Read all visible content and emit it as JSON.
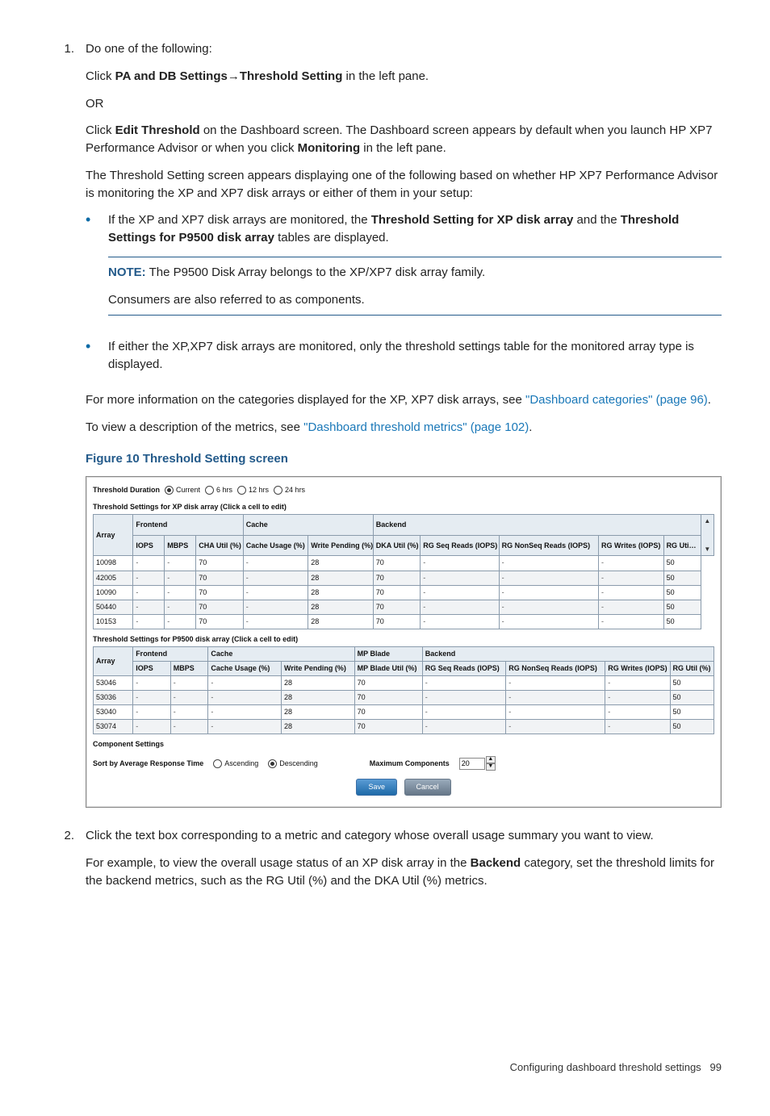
{
  "step1": {
    "num": "1.",
    "intro": "Do one of the following:",
    "click1_a": "Click ",
    "click1_b": "PA and DB Settings",
    "click1_c": "→",
    "click1_d": "Threshold Setting",
    "click1_e": " in the left pane.",
    "or": "OR",
    "click2_a": "Click ",
    "click2_b": "Edit Threshold",
    "click2_c": " on the Dashboard screen. The Dashboard screen appears by default when you launch HP XP7 Performance Advisor or when you click ",
    "click2_d": "Monitoring",
    "click2_e": " in the left pane.",
    "para2": "The Threshold Setting screen appears displaying one of the following based on whether HP XP7 Performance Advisor is monitoring the XP and XP7 disk arrays or either of them in your setup:",
    "bullet1_a": "If the XP and XP7 disk arrays are monitored, the ",
    "bullet1_b": "Threshold Setting for XP disk array",
    "bullet1_c": " and the ",
    "bullet1_d": "Threshold Settings for P9500 disk array",
    "bullet1_e": " tables are displayed.",
    "note_label": "NOTE:",
    "note_line1": " The P9500 Disk Array belongs to the XP/XP7 disk array family.",
    "note_line2": "Consumers are also referred to as components.",
    "bullet2": "If either the XP,XP7 disk arrays are monitored, only the threshold settings table for the monitored array type is displayed.",
    "more_a": "For more information on the categories displayed for the XP, XP7 disk arrays, see ",
    "more_link1": "\"Dashboard categories\" (page 96)",
    "more_b": ".",
    "desc_a": "To view a description of the metrics, see ",
    "desc_link": "\"Dashboard threshold metrics\" (page 102)",
    "desc_b": ".",
    "figure": "Figure 10 Threshold Setting screen"
  },
  "screenshot": {
    "dur_label": "Threshold Duration",
    "opt_current": "Current",
    "opt_6": "6 hrs",
    "opt_12": "12 hrs",
    "opt_24": "24 hrs",
    "xp_title": "Threshold Settings for XP disk array (Click a cell to edit)",
    "p95_title": "Threshold Settings for P9500 disk array (Click a cell to edit)",
    "col_array": "Array",
    "col_frontend": "Frontend",
    "col_cache": "Cache",
    "col_backend": "Backend",
    "col_mpblade": "MP Blade",
    "sub_iops": "IOPS",
    "sub_mbps": "MBPS",
    "sub_cha": "CHA Util (%)",
    "sub_cacheuse": "Cache Usage (%)",
    "sub_wpend": "Write Pending (%)",
    "sub_dka": "DKA Util (%)",
    "sub_rgseq": "RG Seq Reads (IOPS)",
    "sub_rgnonseq": "RG NonSeq Reads (IOPS)",
    "sub_rgwrites": "RG Writes (IOPS)",
    "sub_rgutil": "RG Uti…",
    "sub_rgutil_full": "RG Util (%)",
    "sub_mpbladeutil": "MP Blade Util (%)",
    "xp_rows": [
      {
        "array": "10098",
        "cha": "70",
        "wpend": "28",
        "dka": "70",
        "rgutil": "50"
      },
      {
        "array": "42005",
        "cha": "70",
        "wpend": "28",
        "dka": "70",
        "rgutil": "50",
        "hl": true
      },
      {
        "array": "10090",
        "cha": "70",
        "wpend": "28",
        "dka": "70",
        "rgutil": "50"
      },
      {
        "array": "50440",
        "cha": "70",
        "wpend": "28",
        "dka": "70",
        "rgutil": "50"
      },
      {
        "array": "10153",
        "cha": "70",
        "wpend": "28",
        "dka": "70",
        "rgutil": "50"
      }
    ],
    "p95_rows": [
      {
        "array": "53046",
        "wpend": "28",
        "mpb": "70",
        "rgutil": "50"
      },
      {
        "array": "53036",
        "wpend": "28",
        "mpb": "70",
        "rgutil": "50"
      },
      {
        "array": "53040",
        "wpend": "28",
        "mpb": "70",
        "rgutil": "50"
      },
      {
        "array": "53074",
        "wpend": "28",
        "mpb": "70",
        "rgutil": "50"
      }
    ],
    "comp_label": "Component Settings",
    "sort_label": "Sort by Average Response Time",
    "asc": "Ascending",
    "desc": "Descending",
    "max_label": "Maximum Components",
    "max_val": "20",
    "save": "Save",
    "cancel": "Cancel"
  },
  "step2": {
    "num": "2.",
    "p1": "Click the text box corresponding to a metric and category whose overall usage summary you want to view.",
    "p2_a": "For example, to view the overall usage status of an XP disk array in the ",
    "p2_b": "Backend",
    "p2_c": " category, set the threshold limits for the backend metrics, such as the RG Util (%) and the DKA Util (%) metrics."
  },
  "footer": {
    "text": "Configuring dashboard threshold settings",
    "page": "99"
  }
}
